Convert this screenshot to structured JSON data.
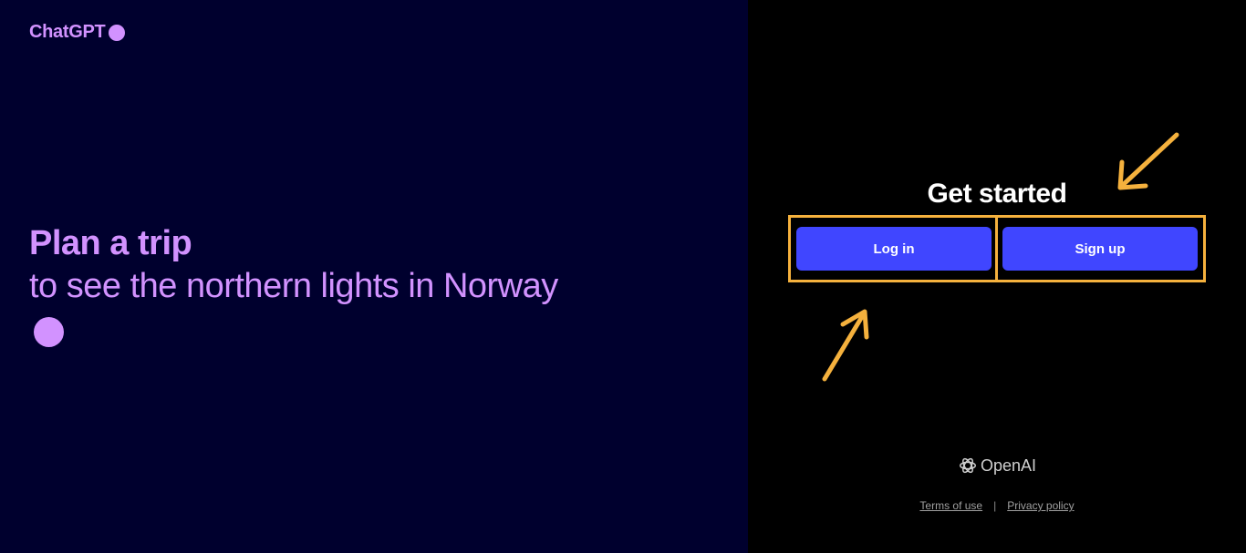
{
  "brand": {
    "name": "ChatGPT"
  },
  "hero": {
    "title": "Plan a trip",
    "subtitle": "to see the northern lights in Norway"
  },
  "auth": {
    "heading": "Get started",
    "login_label": "Log in",
    "signup_label": "Sign up"
  },
  "footer": {
    "logo_text": "OpenAI",
    "terms_label": "Terms of use",
    "separator": "|",
    "privacy_label": "Privacy policy"
  },
  "colors": {
    "left_background": "#00002e",
    "accent_purple": "#d292ff",
    "button_blue": "#4046ff",
    "annotation_orange": "#f5b13d"
  },
  "icons": {
    "logo_icon": "openai-knot-icon",
    "dots": "circle-dot-icon",
    "annotations": "arrow-icon"
  }
}
